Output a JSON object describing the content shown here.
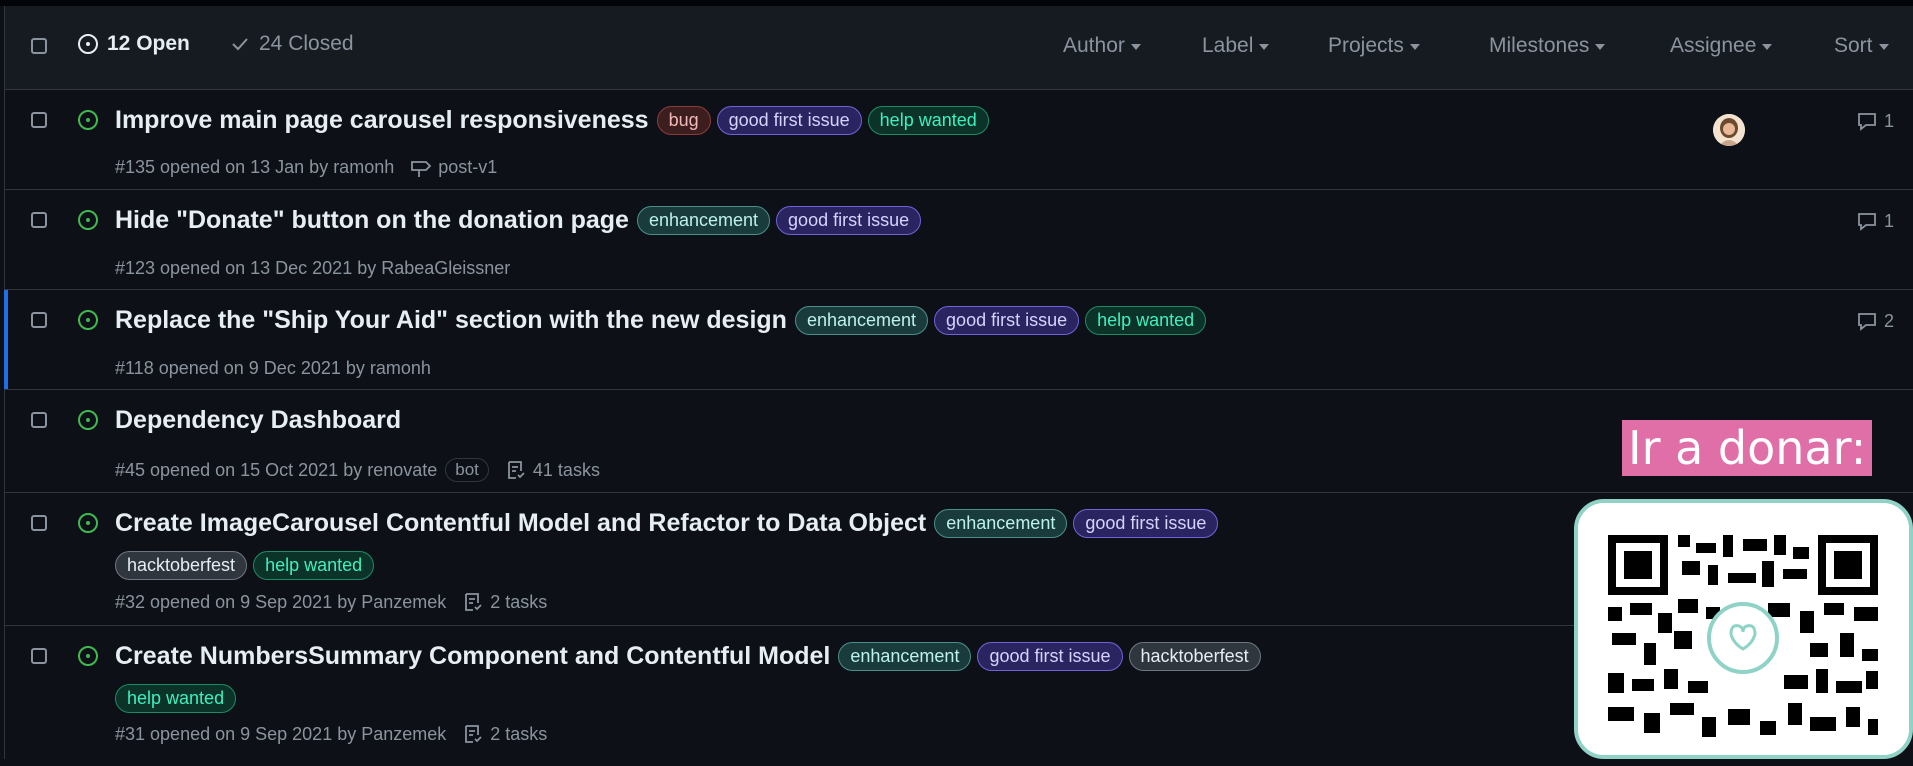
{
  "header": {
    "open_label": "12 Open",
    "closed_label": "24 Closed",
    "filters": [
      "Author",
      "Label",
      "Projects",
      "Milestones",
      "Assignee",
      "Sort"
    ]
  },
  "colors": {
    "open_state": "#3fb950",
    "bug_bg": "#3c1e1e",
    "bug_border": "#8e3a3a",
    "bug_text": "#f2b8b8",
    "good_first_bg": "#2a2560",
    "good_first_border": "#6e63d8",
    "good_first_text": "#d8d2ff",
    "help_bg": "#0b3328",
    "help_border": "#1d8a66",
    "help_text": "#3ff0bf",
    "enh_bg": "#1a3b3b",
    "enh_border": "#4a8f8a",
    "enh_text": "#bdf1ec",
    "hack_bg": "#30363d",
    "hack_border": "#6e7681",
    "hack_text": "#e6edf3",
    "promo_pink": "#e06fa8",
    "qr_border": "#8fd3c7"
  },
  "issues": [
    {
      "title": "Improve main page carousel responsiveness",
      "labels": [
        "bug",
        "good first issue",
        "help wanted"
      ],
      "meta": "#135 opened on 13 Jan by ramonh",
      "milestone": "post-v1",
      "comments": "1"
    },
    {
      "title": "Hide \"Donate\" button on the donation page",
      "labels": [
        "enhancement",
        "good first issue"
      ],
      "meta": "#123 opened on 13 Dec 2021 by RabeaGleissner",
      "comments": "1"
    },
    {
      "title": "Replace the \"Ship Your Aid\" section with the new design",
      "labels": [
        "enhancement",
        "good first issue",
        "help wanted"
      ],
      "meta": "#118 opened on 9 Dec 2021 by ramonh",
      "comments": "2"
    },
    {
      "title": "Dependency Dashboard",
      "labels": [],
      "meta": "#45 opened on 15 Oct 2021 by renovate",
      "badge": "bot",
      "tasks": "41 tasks"
    },
    {
      "title": "Create ImageCarousel Contentful Model and Refactor to Data Object",
      "labels": [
        "enhancement",
        "good first issue"
      ],
      "labels_line2": [
        "hacktoberfest",
        "help wanted"
      ],
      "meta": "#32 opened on 9 Sep 2021 by Panzemek",
      "tasks": "2 tasks"
    },
    {
      "title": "Create NumbersSummary Component and Contentful Model",
      "labels": [
        "enhancement",
        "good first issue",
        "hacktoberfest"
      ],
      "labels_line2": [
        "help wanted"
      ],
      "meta": "#31 opened on 9 Sep 2021 by Panzemek",
      "tasks": "2 tasks"
    }
  ],
  "promo": {
    "text": "Ir a donar:"
  }
}
